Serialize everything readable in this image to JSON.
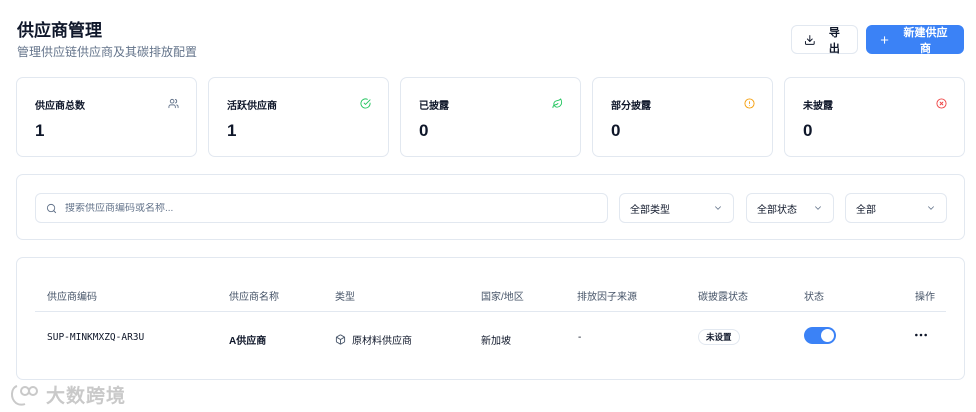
{
  "header": {
    "title": "供应商管理",
    "subtitle": "管理供应链供应商及其碳排放配置",
    "export_label": "导出",
    "new_label": "新建供应商"
  },
  "stats": [
    {
      "label": "供应商总数",
      "value": "1",
      "icon": "users-icon",
      "icon_color": "#64748b"
    },
    {
      "label": "活跃供应商",
      "value": "1",
      "icon": "check-circle-icon",
      "icon_color": "#22c55e"
    },
    {
      "label": "已披露",
      "value": "0",
      "icon": "leaf-icon",
      "icon_color": "#22c55e"
    },
    {
      "label": "部分披露",
      "value": "0",
      "icon": "alert-circle-icon",
      "icon_color": "#f59e0b"
    },
    {
      "label": "未披露",
      "value": "0",
      "icon": "x-circle-icon",
      "icon_color": "#ef4444"
    }
  ],
  "filters": {
    "search_placeholder": "搜索供应商编码或名称...",
    "type_select": "全部类型",
    "status_select": "全部状态",
    "all_select": "全部"
  },
  "table": {
    "columns": [
      "供应商编码",
      "供应商名称",
      "类型",
      "国家/地区",
      "排放因子来源",
      "碳披露状态",
      "状态",
      "操作"
    ],
    "rows": [
      {
        "code": "SUP-MINKMXZQ-AR3U",
        "name": "A供应商",
        "type": "原材料供应商",
        "country": "新加坡",
        "factor_source": "-",
        "disclosure": "未设置",
        "status_on": true
      }
    ]
  },
  "watermark": "大数跨境",
  "colors": {
    "accent": "#3b82f6",
    "border": "#e2e8f0",
    "muted_text": "#64748b"
  }
}
